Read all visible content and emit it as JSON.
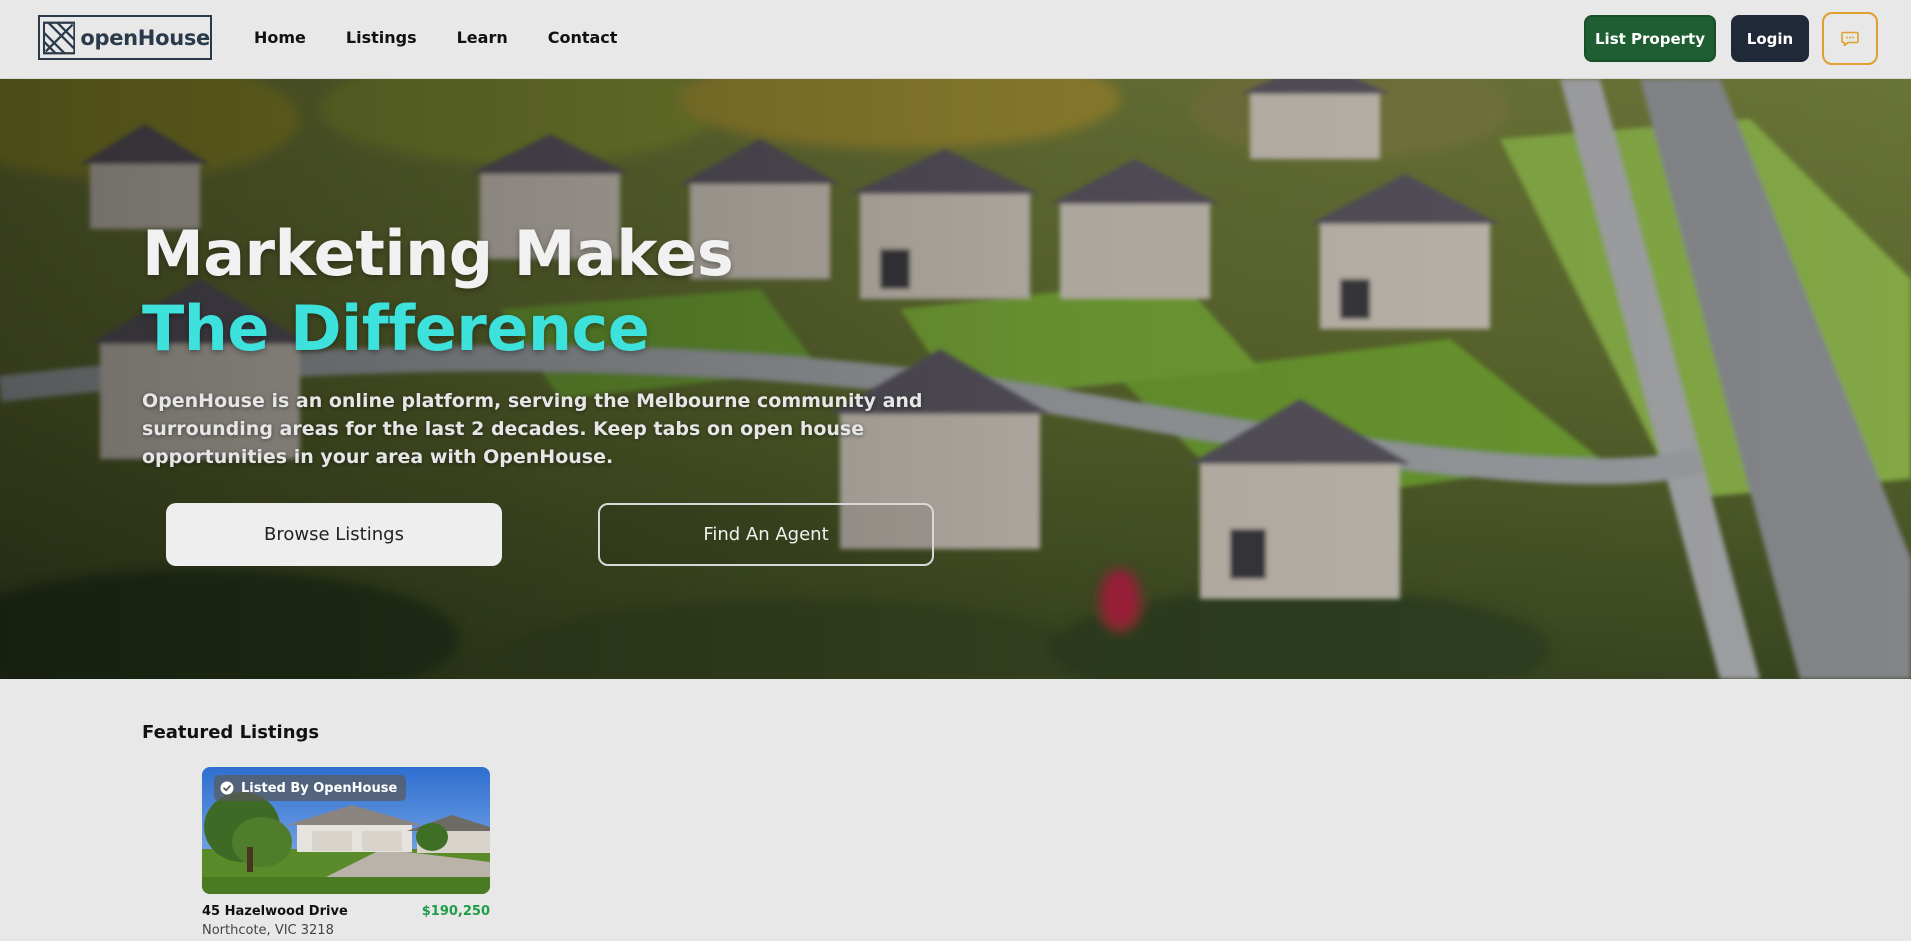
{
  "navbar": {
    "logo_text": "openHouse",
    "links": [
      "Home",
      "Listings",
      "Learn",
      "Contact"
    ],
    "list_property_label": "List Property",
    "login_label": "Login",
    "chat_icon": "chat-icon",
    "colors": {
      "list_property": "#1e5e32",
      "login": "#1f2937",
      "chat_border": "#e0a030"
    }
  },
  "hero": {
    "title_line1": "Marketing Makes",
    "title_line2": "The Difference",
    "description": "OpenHouse is an online platform, serving the Melbourne community and surrounding areas for the last 2 decades. Keep tabs on open house opportunities in your area with OpenHouse.",
    "primary_button": "Browse Listings",
    "secondary_button": "Find An Agent",
    "accent_color": "#3ee2dc"
  },
  "featured": {
    "title": "Featured Listings",
    "listings": [
      {
        "badge": "Listed By OpenHouse",
        "badge_icon": "check-circle-icon",
        "address": "45 Hazelwood Drive",
        "price": "$190,250",
        "suburb": "Northcote, VIC 3218"
      }
    ],
    "price_color": "#1f9d49"
  }
}
